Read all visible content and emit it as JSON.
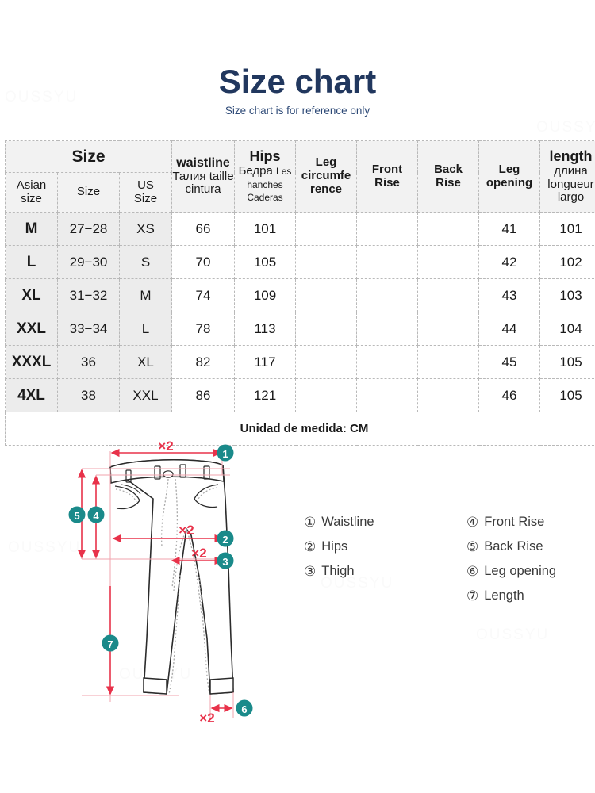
{
  "header": {
    "title": "Size chart",
    "subtitle": "Size chart is for reference only"
  },
  "watermark": {
    "text": "OUSSYU"
  },
  "table": {
    "group_header": "Size",
    "columns": [
      {
        "key": "asian_size",
        "en": "Asian",
        "en2": "size",
        "alt": []
      },
      {
        "key": "size",
        "en": "Size",
        "alt": []
      },
      {
        "key": "us_size",
        "en": "US",
        "en2": "Size",
        "alt": []
      },
      {
        "key": "waistline",
        "en": "waistline",
        "alt": [
          "Талия",
          "taille",
          "cintura"
        ]
      },
      {
        "key": "hips",
        "en": "Hips",
        "alt": [
          "Бедра",
          "Les hanches",
          "Caderas"
        ]
      },
      {
        "key": "leg_circumference",
        "en": "Leg circumfe rence",
        "alt": []
      },
      {
        "key": "front_rise",
        "en": "Front Rise",
        "alt": []
      },
      {
        "key": "back_rise",
        "en": "Back Rise",
        "alt": []
      },
      {
        "key": "leg_opening",
        "en": "Leg opening",
        "alt": []
      },
      {
        "key": "length",
        "en": "length",
        "alt": [
          "длина",
          "longueur",
          "largo"
        ]
      }
    ],
    "column_labels": {
      "asian_size_l1": "Asian",
      "asian_size_l2": "size",
      "size": "Size",
      "us_size_l1": "US",
      "us_size_l2": "Size",
      "waistline_en": "waistline",
      "waistline_ru": "Талия",
      "waistline_fr": "taille",
      "waistline_es": "cintura",
      "hips_en": "Hips",
      "hips_ru": "Бедра",
      "hips_fr": "Les hanches",
      "hips_es": "Caderas",
      "leg_circ_l1": "Leg",
      "leg_circ_l2": "circumfe",
      "leg_circ_l3": "rence",
      "front_rise_l1": "Front",
      "front_rise_l2": "Rise",
      "back_rise_l1": "Back",
      "back_rise_l2": "Rise",
      "leg_opening_l1": "Leg",
      "leg_opening_l2": "opening",
      "length_en": "length",
      "length_ru": "длина",
      "length_fr": "longueur",
      "length_es": "largo"
    },
    "rows": [
      {
        "asian_size": "M",
        "size": "27−28",
        "us_size": "XS",
        "waistline": "66",
        "hips": "101",
        "leg_circumference": "",
        "front_rise": "",
        "back_rise": "",
        "leg_opening": "41",
        "length": "101"
      },
      {
        "asian_size": "L",
        "size": "29−30",
        "us_size": "S",
        "waistline": "70",
        "hips": "105",
        "leg_circumference": "",
        "front_rise": "",
        "back_rise": "",
        "leg_opening": "42",
        "length": "102"
      },
      {
        "asian_size": "XL",
        "size": "31−32",
        "us_size": "M",
        "waistline": "74",
        "hips": "109",
        "leg_circumference": "",
        "front_rise": "",
        "back_rise": "",
        "leg_opening": "43",
        "length": "103"
      },
      {
        "asian_size": "XXL",
        "size": "33−34",
        "us_size": "L",
        "waistline": "78",
        "hips": "113",
        "leg_circumference": "",
        "front_rise": "",
        "back_rise": "",
        "leg_opening": "44",
        "length": "104"
      },
      {
        "asian_size": "XXXL",
        "size": "36",
        "us_size": "XL",
        "waistline": "82",
        "hips": "117",
        "leg_circumference": "",
        "front_rise": "",
        "back_rise": "",
        "leg_opening": "45",
        "length": "105"
      },
      {
        "asian_size": "4XL",
        "size": "38",
        "us_size": "XXL",
        "waistline": "86",
        "hips": "121",
        "leg_circumference": "",
        "front_rise": "",
        "back_rise": "",
        "leg_opening": "46",
        "length": "105"
      }
    ],
    "footnote": "Unidad de medida: CM"
  },
  "diagram": {
    "multiplier_label": "×2",
    "badges": [
      {
        "num": "1",
        "glyph": "❶"
      },
      {
        "num": "2",
        "glyph": "❷"
      },
      {
        "num": "3",
        "glyph": "❸"
      },
      {
        "num": "4",
        "glyph": "❹"
      },
      {
        "num": "5",
        "glyph": "❺"
      },
      {
        "num": "6",
        "glyph": "❻"
      },
      {
        "num": "7",
        "glyph": "❼"
      }
    ],
    "measure_labels": {
      "m1": "×2",
      "m2": "×2",
      "m3": "×2",
      "m6": "×2"
    }
  },
  "legend": {
    "left": [
      {
        "num": "①",
        "label": "Waistline"
      },
      {
        "num": "②",
        "label": "Hips"
      },
      {
        "num": "③",
        "label": "Thigh"
      }
    ],
    "right": [
      {
        "num": "④",
        "label": "Front Rise"
      },
      {
        "num": "⑤",
        "label": "Back Rise"
      },
      {
        "num": "⑥",
        "label": "Leg opening"
      },
      {
        "num": "⑦",
        "label": "Length"
      }
    ]
  },
  "colors": {
    "title_navy": "#21375e",
    "badge_teal": "#1a8a8a",
    "measure_red": "#e8324a",
    "border_gray": "#b9b9b9",
    "header_bg": "#f2f2f2",
    "size_cell_bg": "#ececec"
  }
}
